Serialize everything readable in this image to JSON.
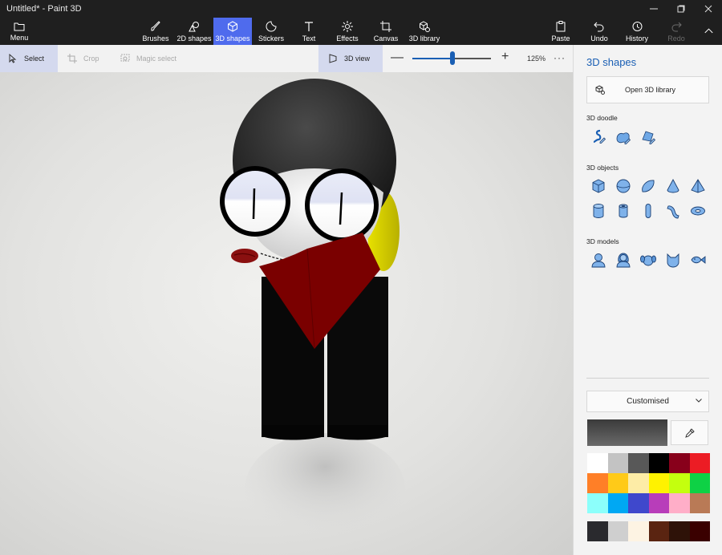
{
  "window": {
    "title": "Untitled* - Paint 3D",
    "controls": [
      "minimize",
      "restore",
      "close"
    ]
  },
  "ribbon": {
    "menu_label": "Menu",
    "tools": [
      {
        "label": "Brushes",
        "icon": "brush-icon"
      },
      {
        "label": "2D shapes",
        "icon": "2d-shapes-icon"
      },
      {
        "label": "3D shapes",
        "icon": "3d-shapes-icon",
        "active": true
      },
      {
        "label": "Stickers",
        "icon": "stickers-icon"
      },
      {
        "label": "Text",
        "icon": "text-icon"
      },
      {
        "label": "Effects",
        "icon": "effects-icon"
      },
      {
        "label": "Canvas",
        "icon": "canvas-icon"
      },
      {
        "label": "3D library",
        "icon": "3d-library-icon"
      }
    ],
    "actions": [
      {
        "label": "Paste",
        "icon": "paste-icon"
      },
      {
        "label": "Undo",
        "icon": "undo-icon"
      },
      {
        "label": "History",
        "icon": "history-icon"
      },
      {
        "label": "Redo",
        "icon": "redo-icon",
        "disabled": true
      }
    ]
  },
  "subtoolbar": {
    "select_label": "Select",
    "crop_label": "Crop",
    "magic_select_label": "Magic select",
    "view_3d_label": "3D view",
    "zoom_value": "125%",
    "zoom_level": 0.5,
    "more_label": "···"
  },
  "panel": {
    "title": "3D shapes",
    "open_library_label": "Open 3D library",
    "doodle_label": "3D doodle",
    "objects_label": "3D objects",
    "models_label": "3D models",
    "doodles": [
      "sharp-doodle-icon",
      "soft-doodle-icon",
      "tube-doodle-icon"
    ],
    "objects_row1": [
      "cube-icon",
      "sphere-icon",
      "hemisphere-icon",
      "cone-icon",
      "pyramid-icon"
    ],
    "objects_row2": [
      "cylinder-icon",
      "tube-icon",
      "capsule-icon",
      "curved-tube-icon",
      "donut-icon"
    ],
    "models": [
      "man-icon",
      "woman-icon",
      "dog-icon",
      "cat-icon",
      "fish-icon"
    ],
    "color_mode": "Customised",
    "current_color": "#4a4a4a",
    "palette": [
      "#ffffff",
      "#c3c3c3",
      "#585858",
      "#000000",
      "#88001b",
      "#ec1c24",
      "#ff7f27",
      "#ffca18",
      "#fdeca6",
      "#fff200",
      "#c4ff0e",
      "#0ed145",
      "#8cfffb",
      "#00a8f3",
      "#3f48cc",
      "#b83dba",
      "#ffaec8",
      "#b97a56"
    ],
    "palette_custom": [
      "#2a2a2e",
      "#cfcfcf",
      "#fdf3e3",
      "#5a2411",
      "#2e1208",
      "#3a0000"
    ]
  }
}
